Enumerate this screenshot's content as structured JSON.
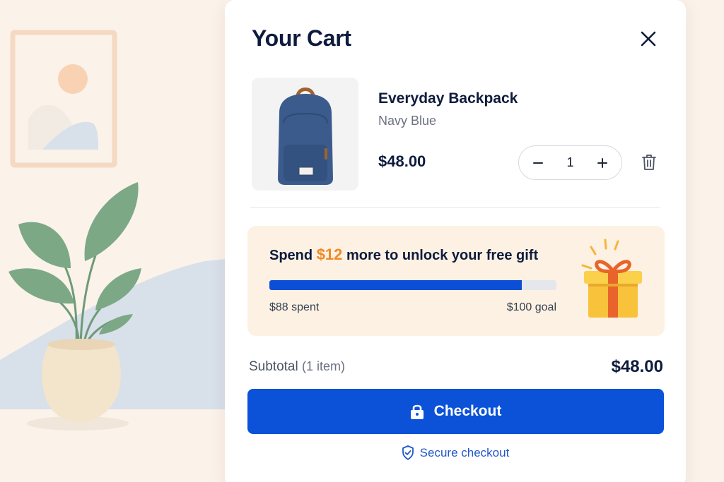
{
  "cart": {
    "title": "Your Cart",
    "close_icon": "close-icon"
  },
  "item": {
    "name": "Everyday Backpack",
    "variant": "Navy Blue",
    "price": "$48.00",
    "quantity": "1",
    "decrement_icon": "minus-icon",
    "increment_icon": "plus-icon",
    "remove_icon": "trash-icon"
  },
  "free_gift": {
    "headline_prefix": "Spend",
    "amount": "$12",
    "headline_suffix": "more to unlock your free gift",
    "spent_label": "$88 spent",
    "goal_label": "$100 goal",
    "progress_percent": 88,
    "icon": "gift-icon"
  },
  "summary": {
    "subtotal_label": "Subtotal",
    "item_count": "(1 item)",
    "subtotal_amount": "$48.00"
  },
  "checkout": {
    "button_label": "Checkout",
    "button_icon": "lock-icon",
    "secure_label": "Secure checkout",
    "secure_icon": "shield-check-icon"
  },
  "colors": {
    "accent": "#0b52d9",
    "highlight": "#f08a24",
    "background": "#fbf2ea",
    "gift_card_background": "#fdf1e3"
  }
}
